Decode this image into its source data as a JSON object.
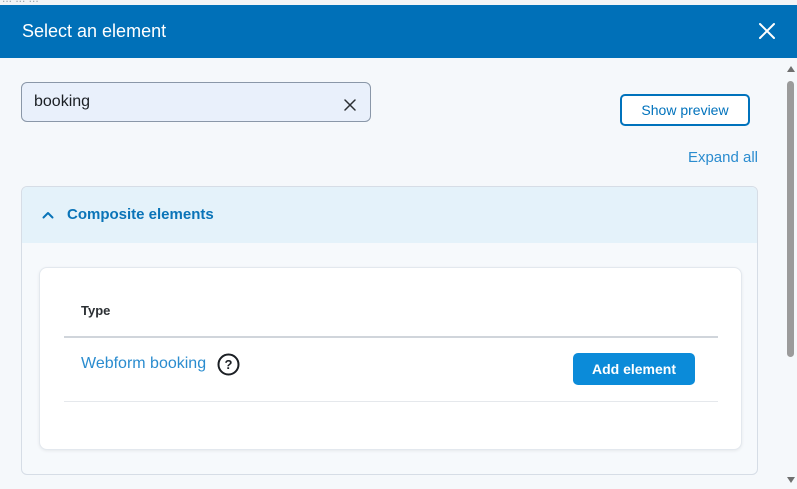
{
  "background_page": {
    "partial_text": "... ... ..."
  },
  "dialog": {
    "title": "Select an element",
    "header_color": "#0070b8"
  },
  "search": {
    "value": "booking",
    "placeholder": ""
  },
  "toolbar": {
    "show_preview_label": "Show preview",
    "expand_all_label": "Expand all"
  },
  "section": {
    "title": "Composite elements",
    "expanded": true,
    "table": {
      "column_header": "Type",
      "rows": [
        {
          "name": "Webform booking",
          "help": "?",
          "action_label": "Add element"
        }
      ]
    }
  },
  "colors": {
    "accent": "#0072bc",
    "link": "#2a8ccf",
    "primary_button": "#0b8bd9"
  },
  "icons": {
    "close": "close-icon",
    "clear": "clear-icon",
    "collapse": "chevron-up-icon",
    "help": "help-icon"
  }
}
